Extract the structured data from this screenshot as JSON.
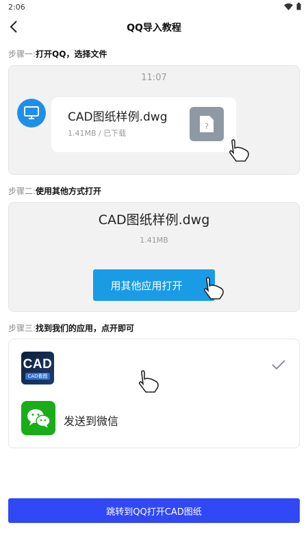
{
  "status_bar": {
    "time": "2:06",
    "icons": [
      "wifi-icon",
      "battery-icon"
    ]
  },
  "header": {
    "title": "QQ导入教程",
    "back_icon": "chevron-left-icon"
  },
  "steps": [
    {
      "prefix": "步骤一:",
      "text": "打开QQ，选择文件"
    },
    {
      "prefix": "步骤二:",
      "text": "使用其他方式打开"
    },
    {
      "prefix": "步骤三:",
      "text": "找到我们的应用，点开即可"
    }
  ],
  "step1": {
    "chat_time": "11:07",
    "file_name": "CAD图纸样例.dwg",
    "file_meta": "1.41MB / 已下载"
  },
  "step2": {
    "file_name": "CAD图纸样例.dwg",
    "file_size": "1.41MB",
    "open_button": "用其他应用打开"
  },
  "step3": {
    "app_icon_title": "CAD",
    "app_icon_subtitle": "CAD看图",
    "wechat_label": "发送到微信"
  },
  "bottom_button": "跳转到QQ打开CAD图纸",
  "colors": {
    "primary": "#3048f5",
    "open_button": "#1a9be6",
    "avatar": "#1e8fe8",
    "wechat": "#1aad19"
  }
}
